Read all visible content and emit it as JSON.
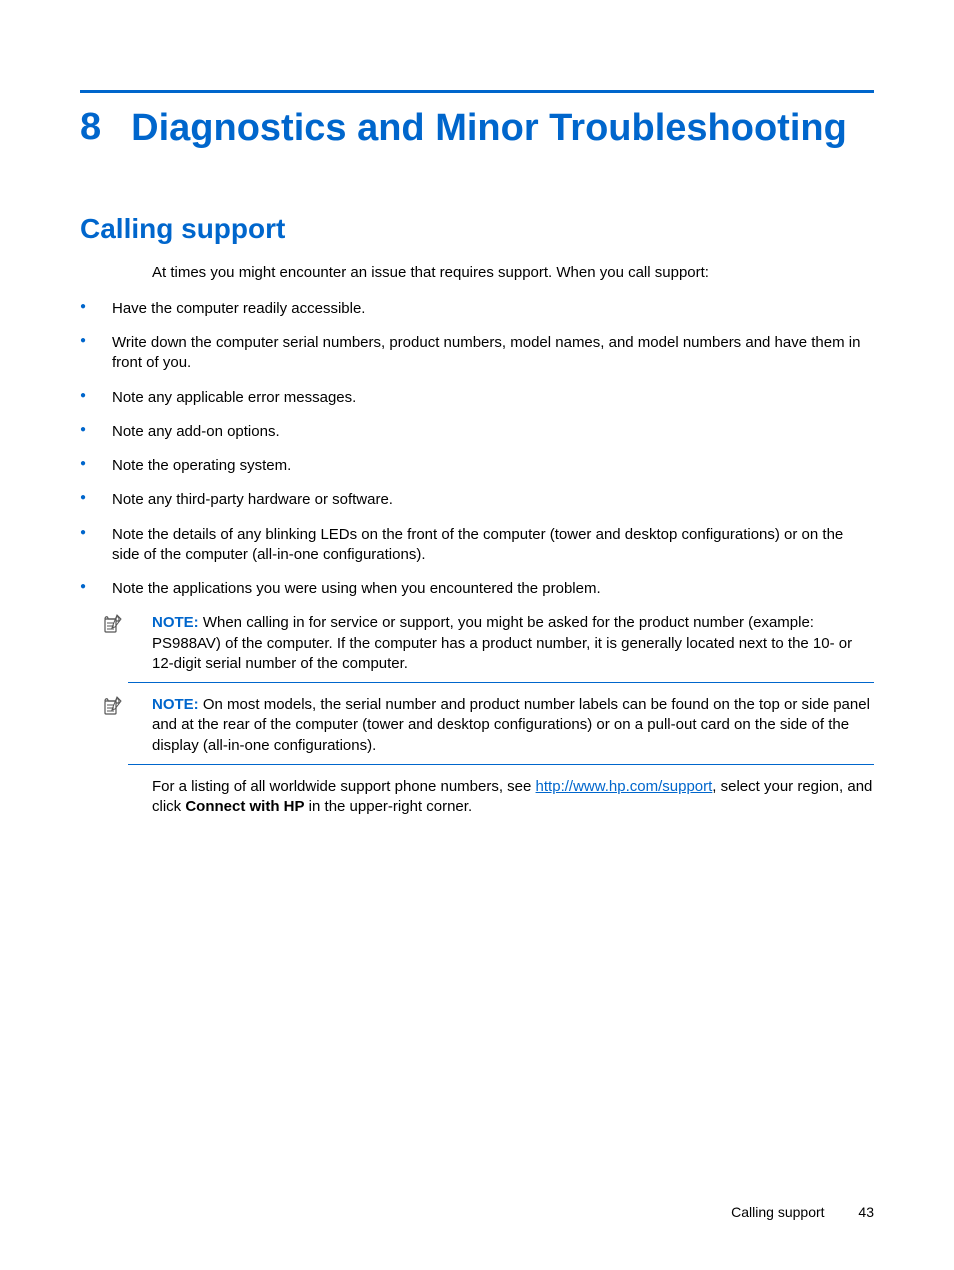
{
  "chapter": {
    "number": "8",
    "title": "Diagnostics and Minor Troubleshooting"
  },
  "section": {
    "heading": "Calling support",
    "intro": "At times you might encounter an issue that requires support. When you call support:",
    "bullets": [
      "Have the computer readily accessible.",
      "Write down the computer serial numbers, product numbers, model names, and model numbers and have them in front of you.",
      "Note any applicable error messages.",
      "Note any add-on options.",
      "Note the operating system.",
      "Note any third-party hardware or software.",
      "Note the details of any blinking LEDs on the front of the computer (tower and desktop configurations) or on the side of the computer (all-in-one configurations).",
      "Note the applications you were using when you encountered the problem."
    ]
  },
  "notes": [
    {
      "label": "NOTE:",
      "text": "When calling in for service or support, you might be asked for the product number (example: PS988AV) of the computer. If the computer has a product number, it is generally located next to the 10- or 12-digit serial number of the computer."
    },
    {
      "label": "NOTE:",
      "text": "On most models, the serial number and product number labels can be found on the top or side panel and at the rear of the computer (tower and desktop configurations) or on a pull-out card on the side of the display (all-in-one configurations)."
    }
  ],
  "closing": {
    "pre": "For a listing of all worldwide support phone numbers, see ",
    "link": "http://www.hp.com/support",
    "mid": ", select your region, and click ",
    "bold": "Connect with HP",
    "post": " in the upper-right corner."
  },
  "footer": {
    "label": "Calling support",
    "page": "43"
  }
}
